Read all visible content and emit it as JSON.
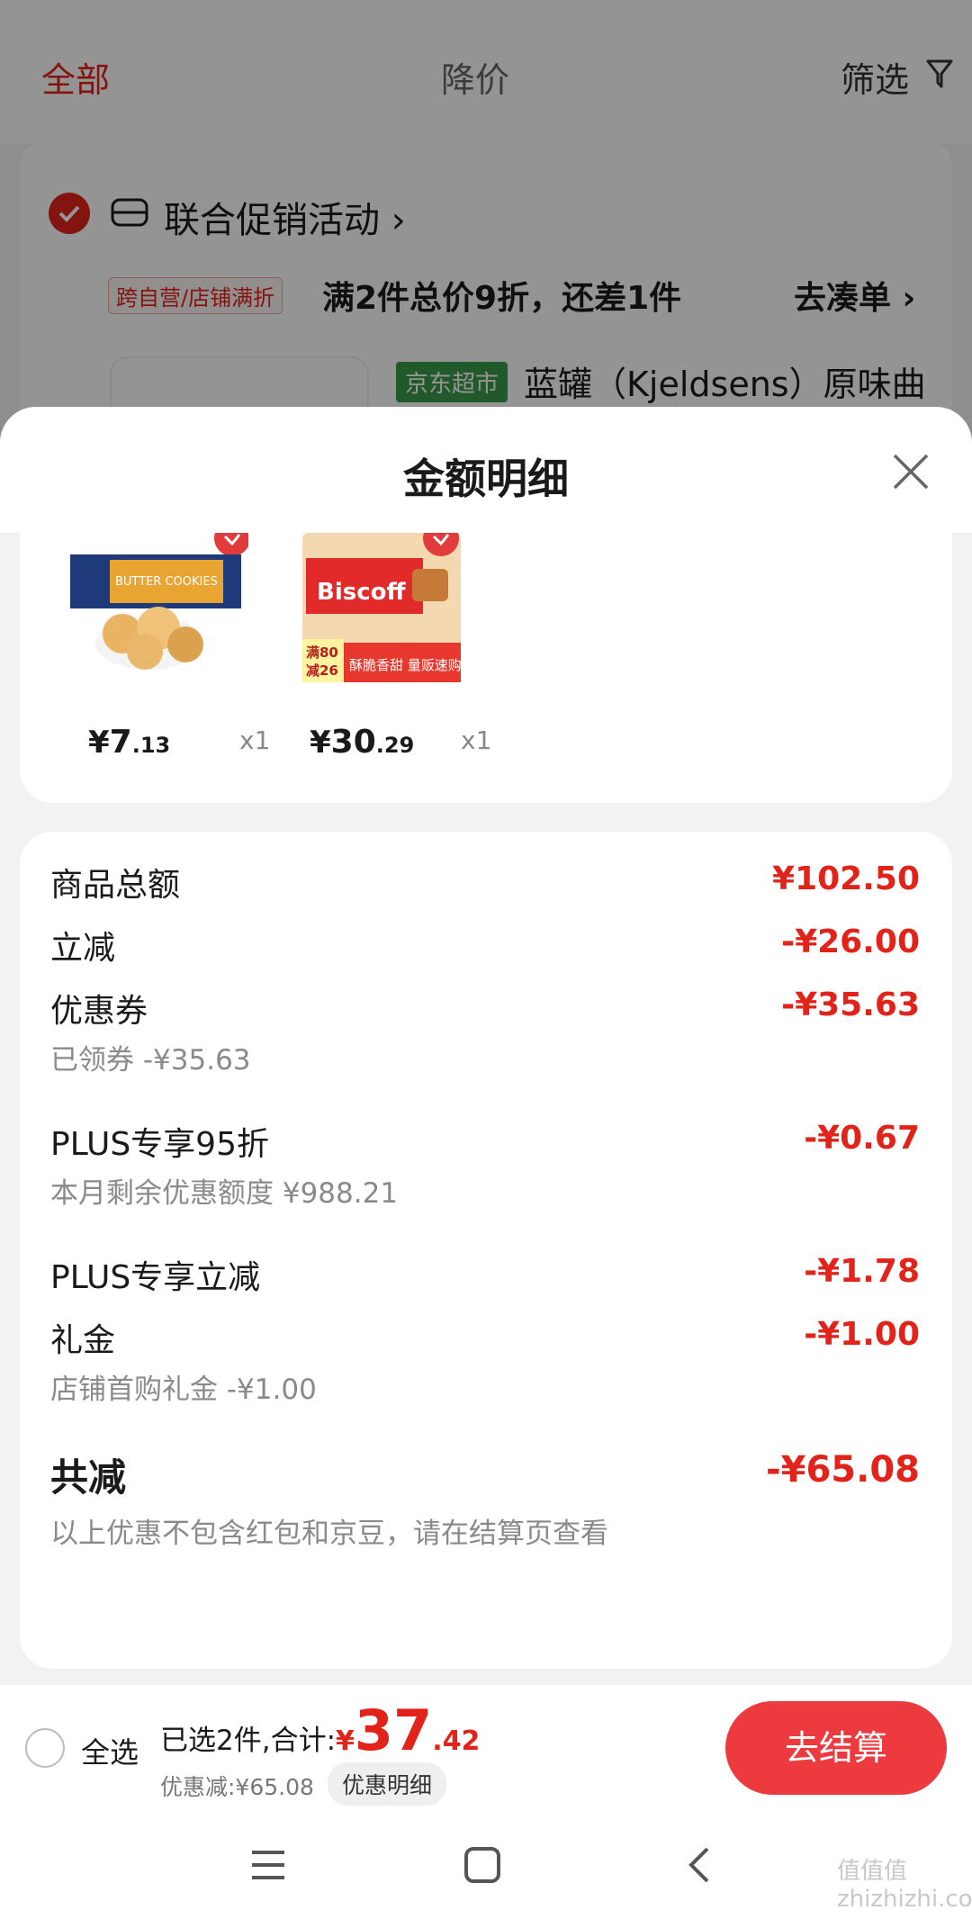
{
  "background_page": {
    "tabs": [
      "全部",
      "降价",
      "筛选"
    ],
    "promo": {
      "title": "联合促销活动 ›",
      "tag": "跨自营/店铺满折",
      "description": "满2件总价9折，还差1件",
      "link": "去凑单 ›"
    },
    "product": {
      "store_tag": "京东超市",
      "name": "蓝罐（Kjeldsens）原味曲"
    }
  },
  "sheet": {
    "title": "金额明细",
    "items": [
      {
        "price_symbol": "¥",
        "price_int": "7",
        "price_dec": ".13",
        "qty": "x1"
      },
      {
        "price_symbol": "¥",
        "price_int": "30",
        "price_dec": ".29",
        "qty": "x1"
      }
    ],
    "item2_badge": {
      "line1": "满80",
      "line2": "减26",
      "slogan": "酥脆香甜 量贩速购"
    },
    "item1_box_text": "BUTTER COOKIES",
    "item2_brand": "Biscoff",
    "rows": [
      {
        "label": "商品总额",
        "amount": "¥102.50",
        "sub": ""
      },
      {
        "label": "立减",
        "amount": "-¥26.00",
        "sub": ""
      },
      {
        "label": "优惠券",
        "amount": "-¥35.63",
        "sub": "已领券 -¥35.63"
      },
      {
        "label": "PLUS专享95折",
        "amount": "-¥0.67",
        "sub": "本月剩余优惠额度 ¥988.21"
      },
      {
        "label": "PLUS专享立减",
        "amount": "-¥1.78",
        "sub": ""
      },
      {
        "label": "礼金",
        "amount": "-¥1.00",
        "sub": "店铺首购礼金 -¥1.00"
      }
    ],
    "total": {
      "label": "共减",
      "amount": "-¥65.08",
      "note": "以上优惠不包含红包和京豆，请在结算页查看"
    }
  },
  "checkout": {
    "select_all": "全选",
    "summary_text": "已选2件,合计:",
    "total_symbol": "¥",
    "total_int": "37",
    "total_dec": ".42",
    "savings": "优惠减:¥65.08",
    "detail_pill": "优惠明细",
    "button": "去结算"
  },
  "watermark": "值值值 zhizhizhi.com",
  "colors": {
    "accent": "#e2231a",
    "button": "#ec3a3e",
    "store_green": "#3a9a4a"
  },
  "icons": [
    "filter-icon",
    "checkmark-icon",
    "promo-icon",
    "close-icon",
    "menu-icon",
    "home-icon",
    "back-icon"
  ]
}
